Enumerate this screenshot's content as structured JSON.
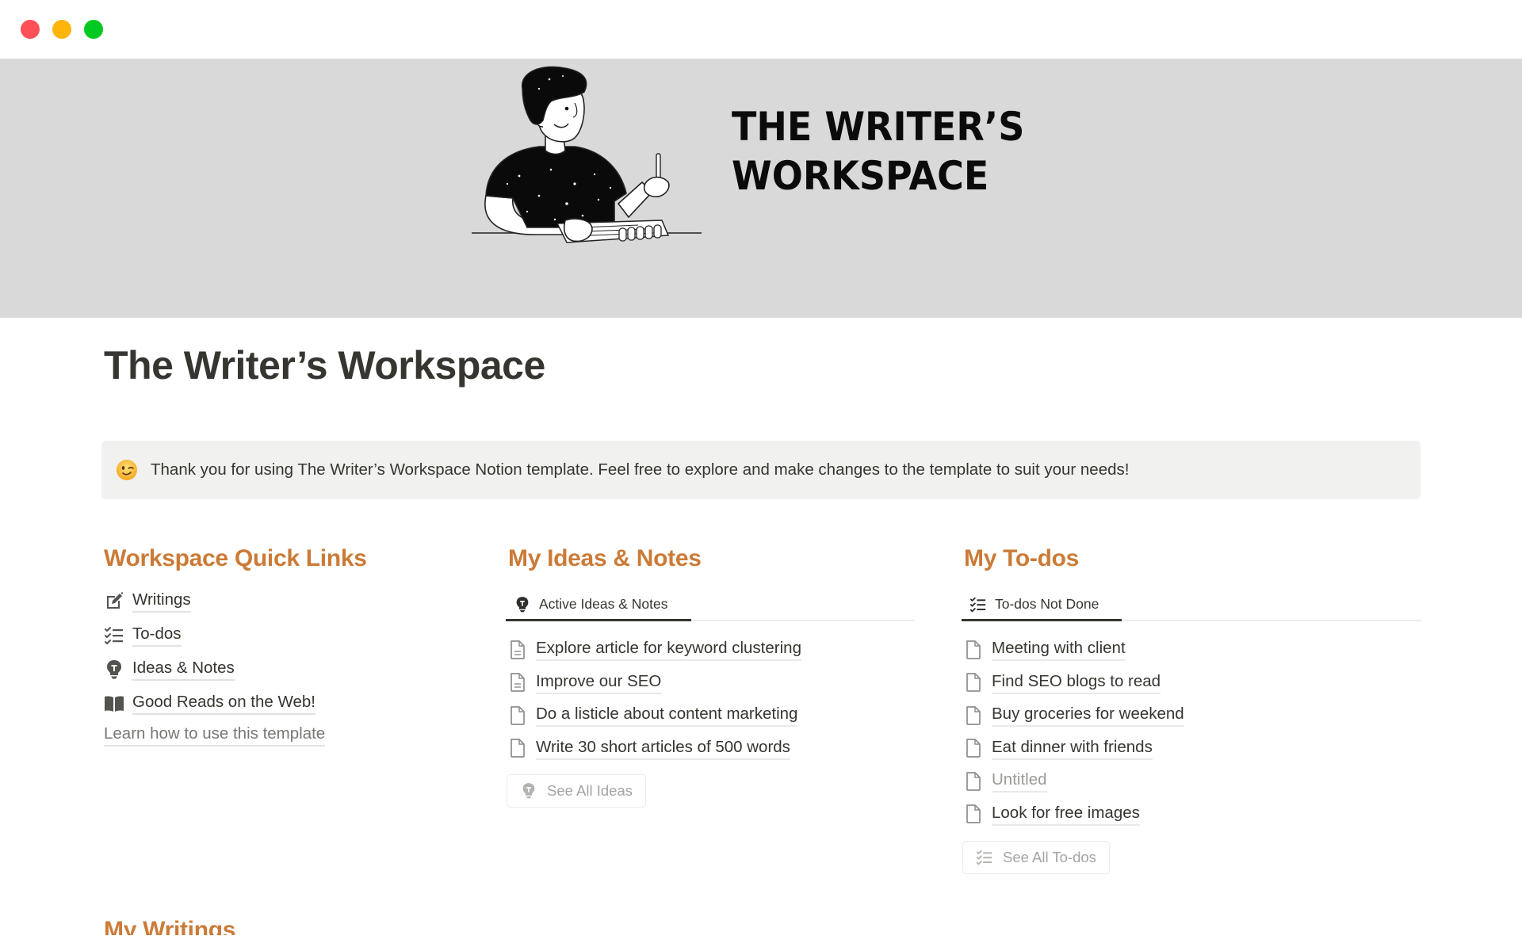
{
  "window": {
    "controls": [
      "close",
      "minimize",
      "zoom"
    ]
  },
  "banner": {
    "title_line1": "THE WRITER’S",
    "title_line2": "WORKSPACE",
    "background": "#d9d9d9",
    "illustration": "person-writing-with-pencil-and-notebook"
  },
  "page": {
    "title": "The Writer’s Workspace"
  },
  "callout": {
    "emoji": "winking-face",
    "text": "Thank you for using The Writer’s Workspace Notion template. Feel free to explore and make changes to the template to suit your needs!"
  },
  "accent_color": "#cb7b37",
  "quick_links": {
    "heading": "Workspace Quick Links",
    "items": [
      {
        "label": "Writings",
        "icon": "edit-icon"
      },
      {
        "label": "To-dos",
        "icon": "checklist-icon"
      },
      {
        "label": "Ideas & Notes",
        "icon": "lightbulb-icon"
      },
      {
        "label": "Good Reads on the Web!",
        "icon": "book-icon"
      }
    ],
    "learn_link": "Learn how to use this template"
  },
  "ideas": {
    "heading": "My Ideas & Notes",
    "tab": {
      "label": "Active Ideas & Notes",
      "icon": "lightbulb-icon"
    },
    "items": [
      {
        "label": "Explore article for keyword clustering",
        "icon": "document-text-icon"
      },
      {
        "label": "Improve our SEO",
        "icon": "document-text-icon"
      },
      {
        "label": "Do a listicle about content marketing",
        "icon": "document-icon"
      },
      {
        "label": "Write 30 short articles of 500 words",
        "icon": "document-icon"
      }
    ],
    "see_all": {
      "label": "See All Ideas",
      "icon": "lightbulb-icon"
    }
  },
  "todos": {
    "heading": "My To-dos",
    "tab": {
      "label": "To-dos Not Done",
      "icon": "checklist-icon"
    },
    "items": [
      {
        "label": "Meeting with client",
        "muted": false
      },
      {
        "label": "Find SEO blogs to read",
        "muted": false
      },
      {
        "label": "Buy groceries for weekend",
        "muted": false
      },
      {
        "label": "Eat dinner with friends",
        "muted": false
      },
      {
        "label": "Untitled",
        "muted": true
      },
      {
        "label": "Look for free images",
        "muted": false
      }
    ],
    "see_all": {
      "label": "See All To-dos",
      "icon": "checklist-icon"
    }
  },
  "writings": {
    "heading": "My Writings"
  }
}
